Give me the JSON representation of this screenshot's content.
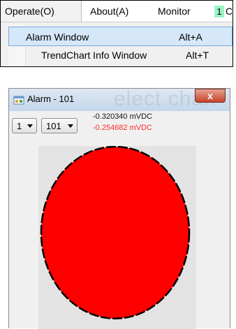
{
  "menubar": {
    "items": [
      "Operate(O)",
      "About(A)",
      "Monitor"
    ],
    "badge": "1",
    "clipped": "C"
  },
  "dropdown": {
    "items": [
      {
        "label": "Alarm Window",
        "shortcut": "Alt+A",
        "highlighted": true
      },
      {
        "label": "TrendChart Info Window",
        "shortcut": "Alt+T",
        "highlighted": false
      }
    ]
  },
  "alarm_window": {
    "title": "Alarm - 101",
    "background_watermark": "elect chan",
    "close_glyph": "x",
    "selectors": [
      {
        "value": "1"
      },
      {
        "value": "101"
      }
    ],
    "readings": [
      {
        "text": "-0.320340 mVDC",
        "color": "#111111"
      },
      {
        "text": "-0.254682 mVDC",
        "color": "#ff2a2a"
      }
    ],
    "indicator": {
      "shape": "ellipse",
      "fill": "#ff0000",
      "outline": "#000000",
      "panel_color": "#e3e3e3"
    }
  }
}
